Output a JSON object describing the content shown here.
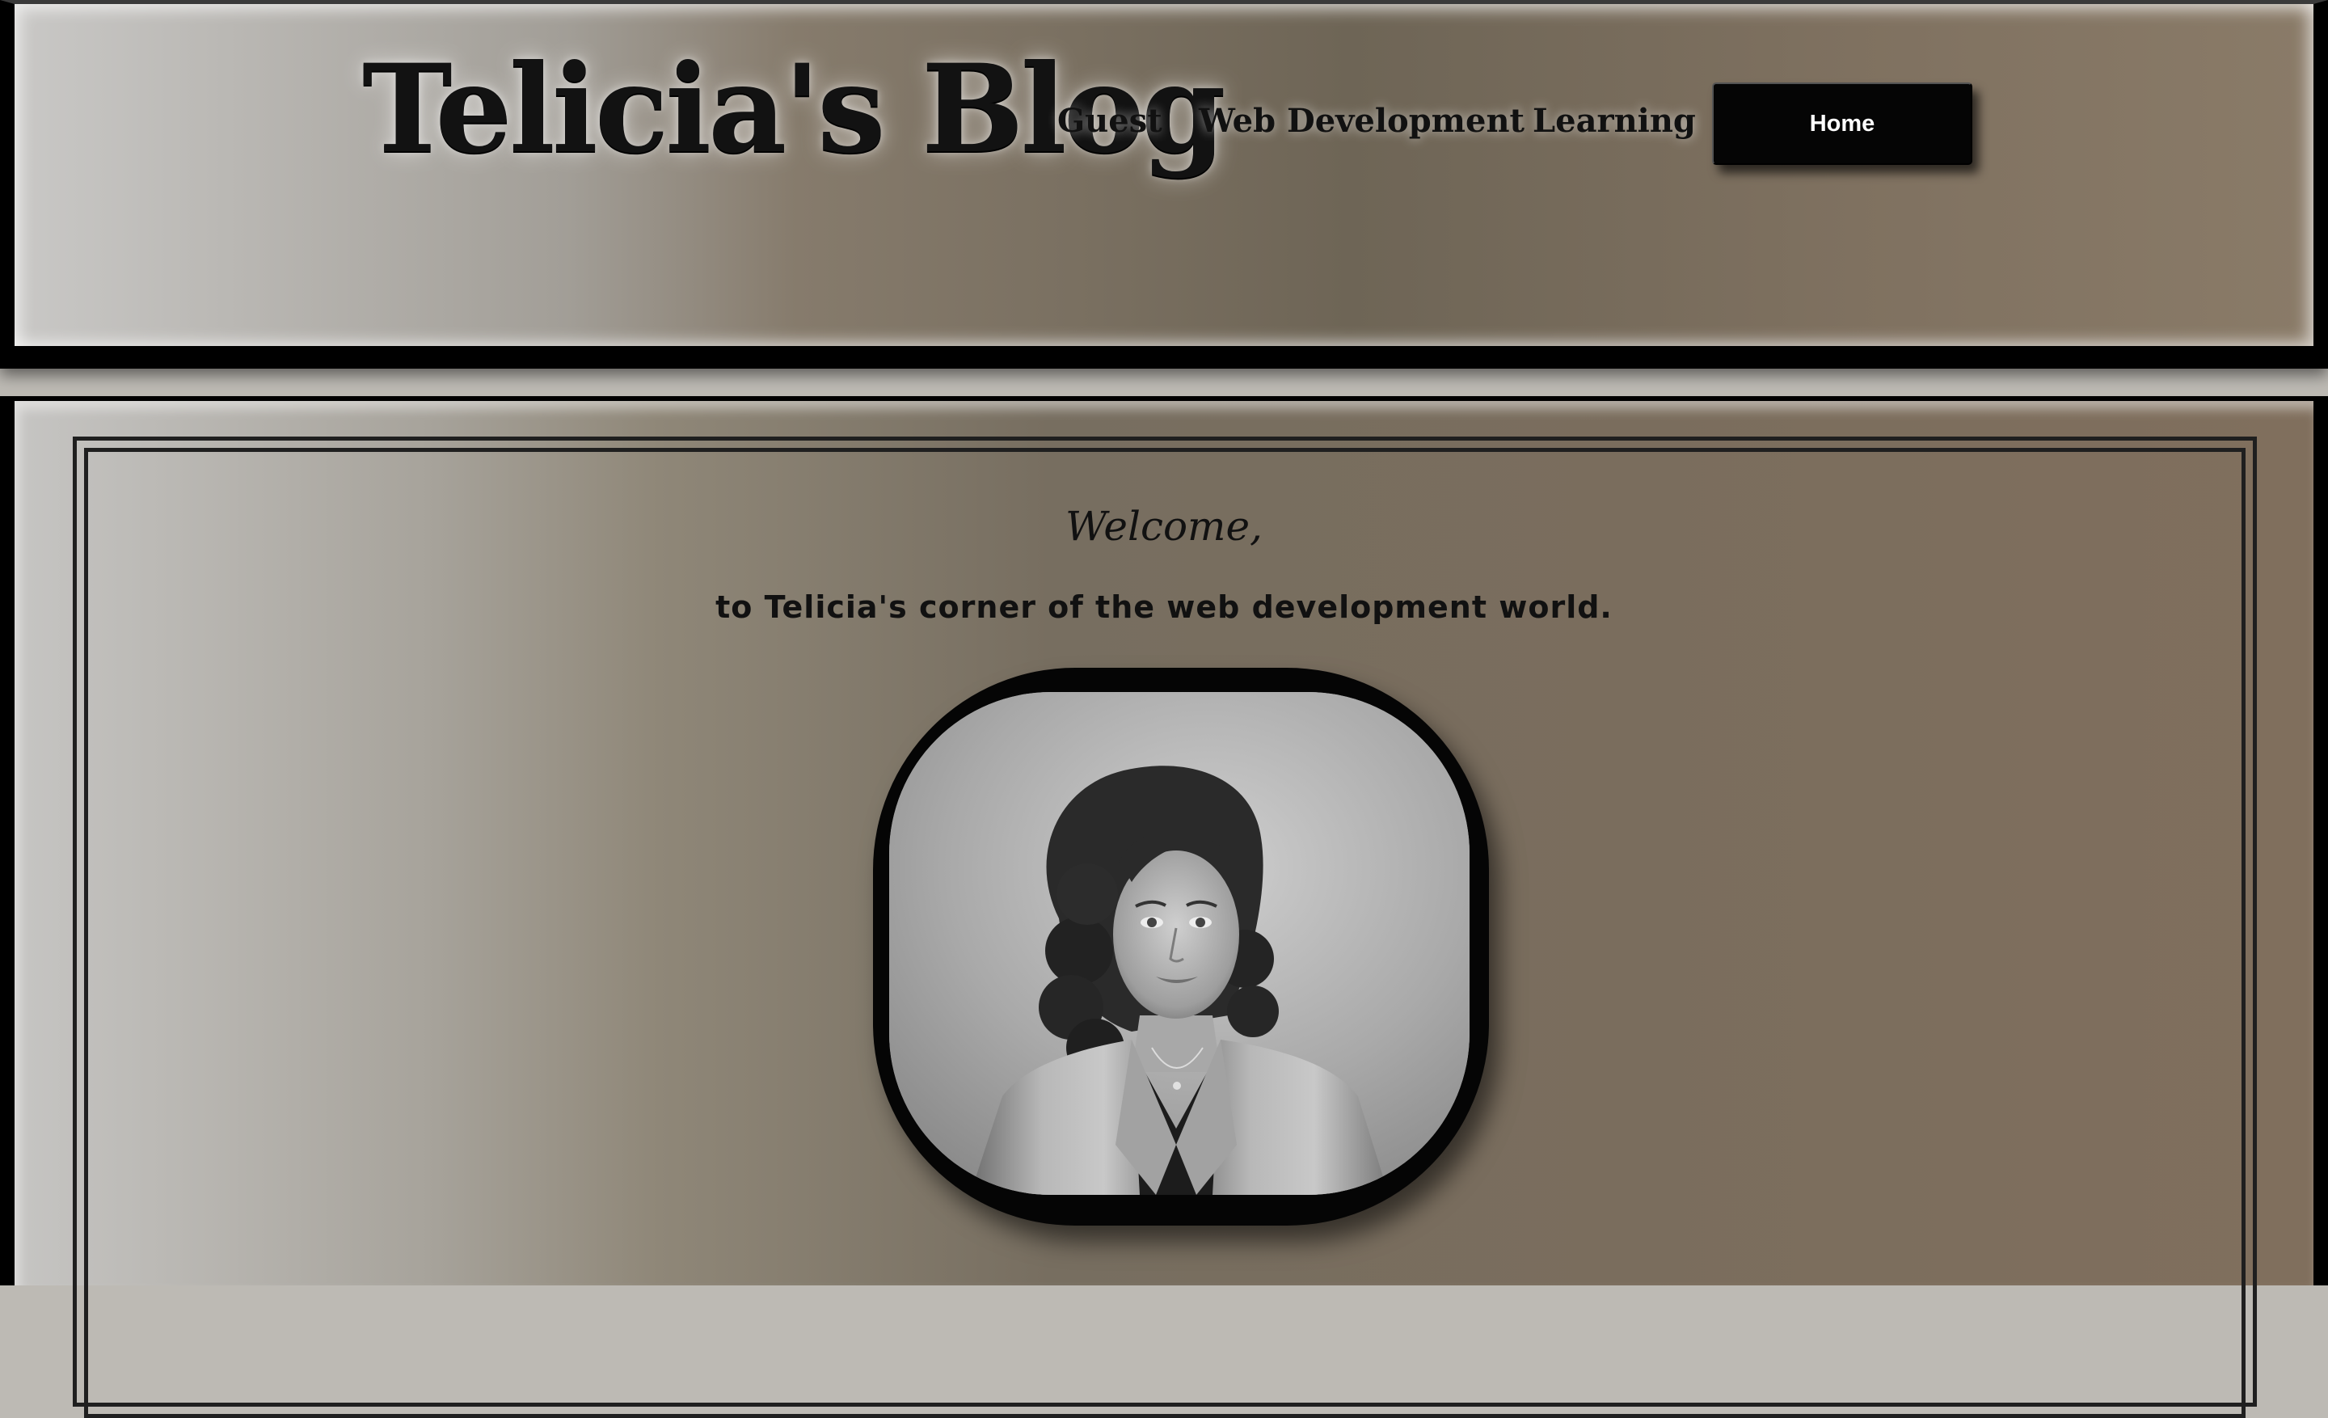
{
  "header": {
    "brand": "Telicia's Blog",
    "nav": {
      "guest": "Guest",
      "web_development": "Web Development",
      "learning": "Learning",
      "home": "Home"
    }
  },
  "main": {
    "welcome": "Welcome,",
    "tagline": "to Telicia's corner of the web development world.",
    "portrait_alt": "portrait-photo"
  },
  "colors": {
    "button": "#050505",
    "button_text": "#ffffff",
    "text": "#111111"
  }
}
